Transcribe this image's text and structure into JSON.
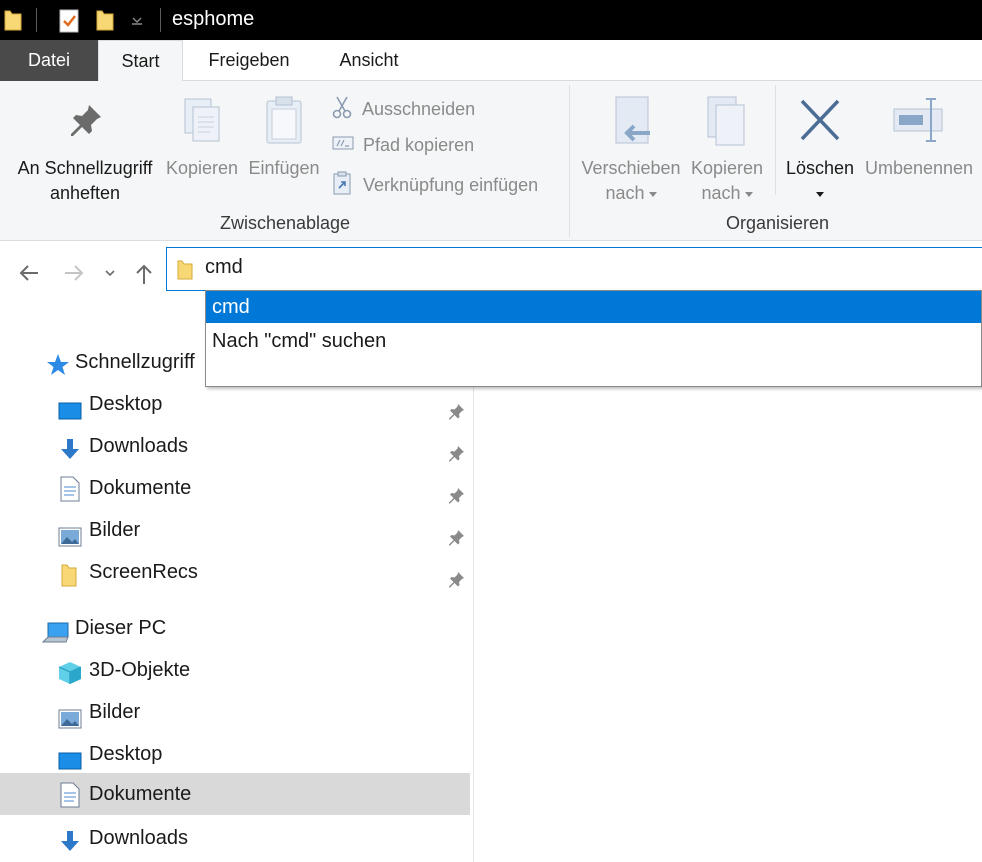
{
  "window": {
    "title": "esphome"
  },
  "tabs": [
    {
      "label": "Datei"
    },
    {
      "label": "Start"
    },
    {
      "label": "Freigeben"
    },
    {
      "label": "Ansicht"
    }
  ],
  "ribbon": {
    "pin_label_line1": "An Schnellzugriff",
    "pin_label_line2": "anheften",
    "copy_label": "Kopieren",
    "paste_label": "Einfügen",
    "cut_label": "Ausschneiden",
    "copy_path_label": "Pfad kopieren",
    "paste_shortcut_label": "Verknüpfung einfügen",
    "clipboard_group": "Zwischenablage",
    "move_to_line1": "Verschieben",
    "move_to_line2": "nach",
    "copy_to_line1": "Kopieren",
    "copy_to_line2": "nach",
    "delete_label": "Löschen",
    "rename_label": "Umbenennen",
    "organize_group": "Organisieren"
  },
  "address_bar": {
    "value": "cmd"
  },
  "suggestions": [
    {
      "label": "cmd",
      "selected": true
    },
    {
      "label": "Nach \"cmd\" suchen",
      "selected": false
    }
  ],
  "tree": {
    "quick_access": "Schnellzugriff",
    "quick_items": [
      {
        "label": "Desktop"
      },
      {
        "label": "Downloads"
      },
      {
        "label": "Dokumente"
      },
      {
        "label": "Bilder"
      },
      {
        "label": "ScreenRecs"
      }
    ],
    "this_pc": "Dieser PC",
    "pc_items": [
      {
        "label": "3D-Objekte"
      },
      {
        "label": "Bilder"
      },
      {
        "label": "Desktop"
      },
      {
        "label": "Dokumente"
      },
      {
        "label": "Downloads"
      }
    ]
  },
  "colors": {
    "accent": "#0078d7",
    "folder": "#f8d775",
    "titlebar": "#000000"
  }
}
